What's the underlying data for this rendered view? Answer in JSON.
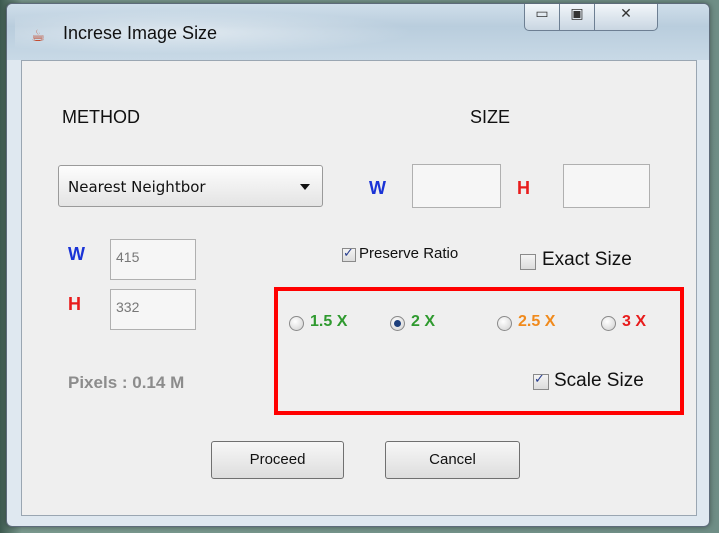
{
  "window": {
    "title": "Increse Image Size",
    "controls": {
      "minimize": "▭",
      "maximize": "▣",
      "close": "✕"
    }
  },
  "labels": {
    "method": "METHOD",
    "size": "SIZE",
    "w": "W",
    "h": "H",
    "pixels": "Pixels : 0.14 M"
  },
  "method_select": {
    "selected": "Nearest Neightbor"
  },
  "target_size": {
    "width": "",
    "height": ""
  },
  "current_size": {
    "width": "415",
    "height": "332"
  },
  "checkboxes": {
    "preserve_ratio": {
      "label": "Preserve Ratio",
      "checked": true
    },
    "exact_size": {
      "label": "Exact Size",
      "checked": false
    },
    "scale_size": {
      "label": "Scale Size",
      "checked": true
    }
  },
  "scale_options": [
    {
      "label": "1.5 X",
      "selected": false,
      "color": "#2f9a2f"
    },
    {
      "label": "2 X",
      "selected": true,
      "color": "#2f9a2f"
    },
    {
      "label": "2.5 X",
      "selected": false,
      "color": "#f08a1c"
    },
    {
      "label": "3 X",
      "selected": false,
      "color": "#e81c1c"
    }
  ],
  "buttons": {
    "proceed": "Proceed",
    "cancel": "Cancel"
  },
  "colors": {
    "highlight_box": "#ff0000",
    "w_label": "#1a33d6",
    "h_label": "#e81c1c"
  }
}
